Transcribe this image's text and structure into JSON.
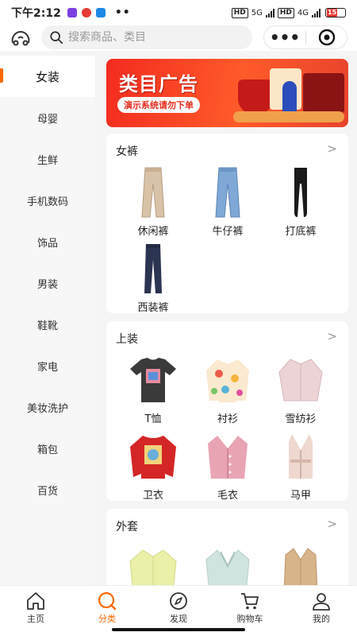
{
  "status_bar": {
    "time": "下午2:12",
    "dots": "••",
    "hd1": "HD",
    "net1": "5G",
    "hd2": "HD",
    "net2": "4G",
    "battery": "15"
  },
  "search": {
    "placeholder": "搜索商品、类目"
  },
  "capsule": {
    "more_label": "•••"
  },
  "sidebar": {
    "items": [
      {
        "label": "女装"
      },
      {
        "label": "母婴"
      },
      {
        "label": "生鲜"
      },
      {
        "label": "手机数码"
      },
      {
        "label": "饰品"
      },
      {
        "label": "男装"
      },
      {
        "label": "鞋靴"
      },
      {
        "label": "家电"
      },
      {
        "label": "美妆洗护"
      },
      {
        "label": "箱包"
      },
      {
        "label": "百货"
      }
    ],
    "active_index": 0
  },
  "banner": {
    "title": "类目广告",
    "subtitle": "演示系统请勿下单"
  },
  "sections": [
    {
      "title": "女裤",
      "arrow": ">",
      "products": [
        {
          "name": "休闲裤",
          "icon": "casual-pants"
        },
        {
          "name": "牛仔裤",
          "icon": "jeans"
        },
        {
          "name": "打底裤",
          "icon": "leggings"
        },
        {
          "name": "西装裤",
          "icon": "suit-pants"
        }
      ]
    },
    {
      "title": "上装",
      "arrow": ">",
      "products": [
        {
          "name": "T恤",
          "icon": "tshirt"
        },
        {
          "name": "衬衫",
          "icon": "shirt"
        },
        {
          "name": "雪纺衫",
          "icon": "chiffon-blouse"
        },
        {
          "name": "卫衣",
          "icon": "sweatshirt"
        },
        {
          "name": "毛衣",
          "icon": "sweater"
        },
        {
          "name": "马甲",
          "icon": "vest"
        }
      ]
    },
    {
      "title": "外套",
      "arrow": ">",
      "products": [
        {
          "name": "",
          "icon": "jacket-yellow"
        },
        {
          "name": "",
          "icon": "blazer"
        },
        {
          "name": "",
          "icon": "trench-coat"
        }
      ]
    }
  ],
  "tabbar": {
    "items": [
      {
        "label": "主页",
        "icon": "home-icon"
      },
      {
        "label": "分类",
        "icon": "category-icon"
      },
      {
        "label": "发现",
        "icon": "compass-icon"
      },
      {
        "label": "购物车",
        "icon": "cart-icon"
      },
      {
        "label": "我的",
        "icon": "profile-icon"
      }
    ],
    "active_index": 1
  },
  "colors": {
    "accent": "#ff6a00",
    "banner": "#f32b1f"
  }
}
